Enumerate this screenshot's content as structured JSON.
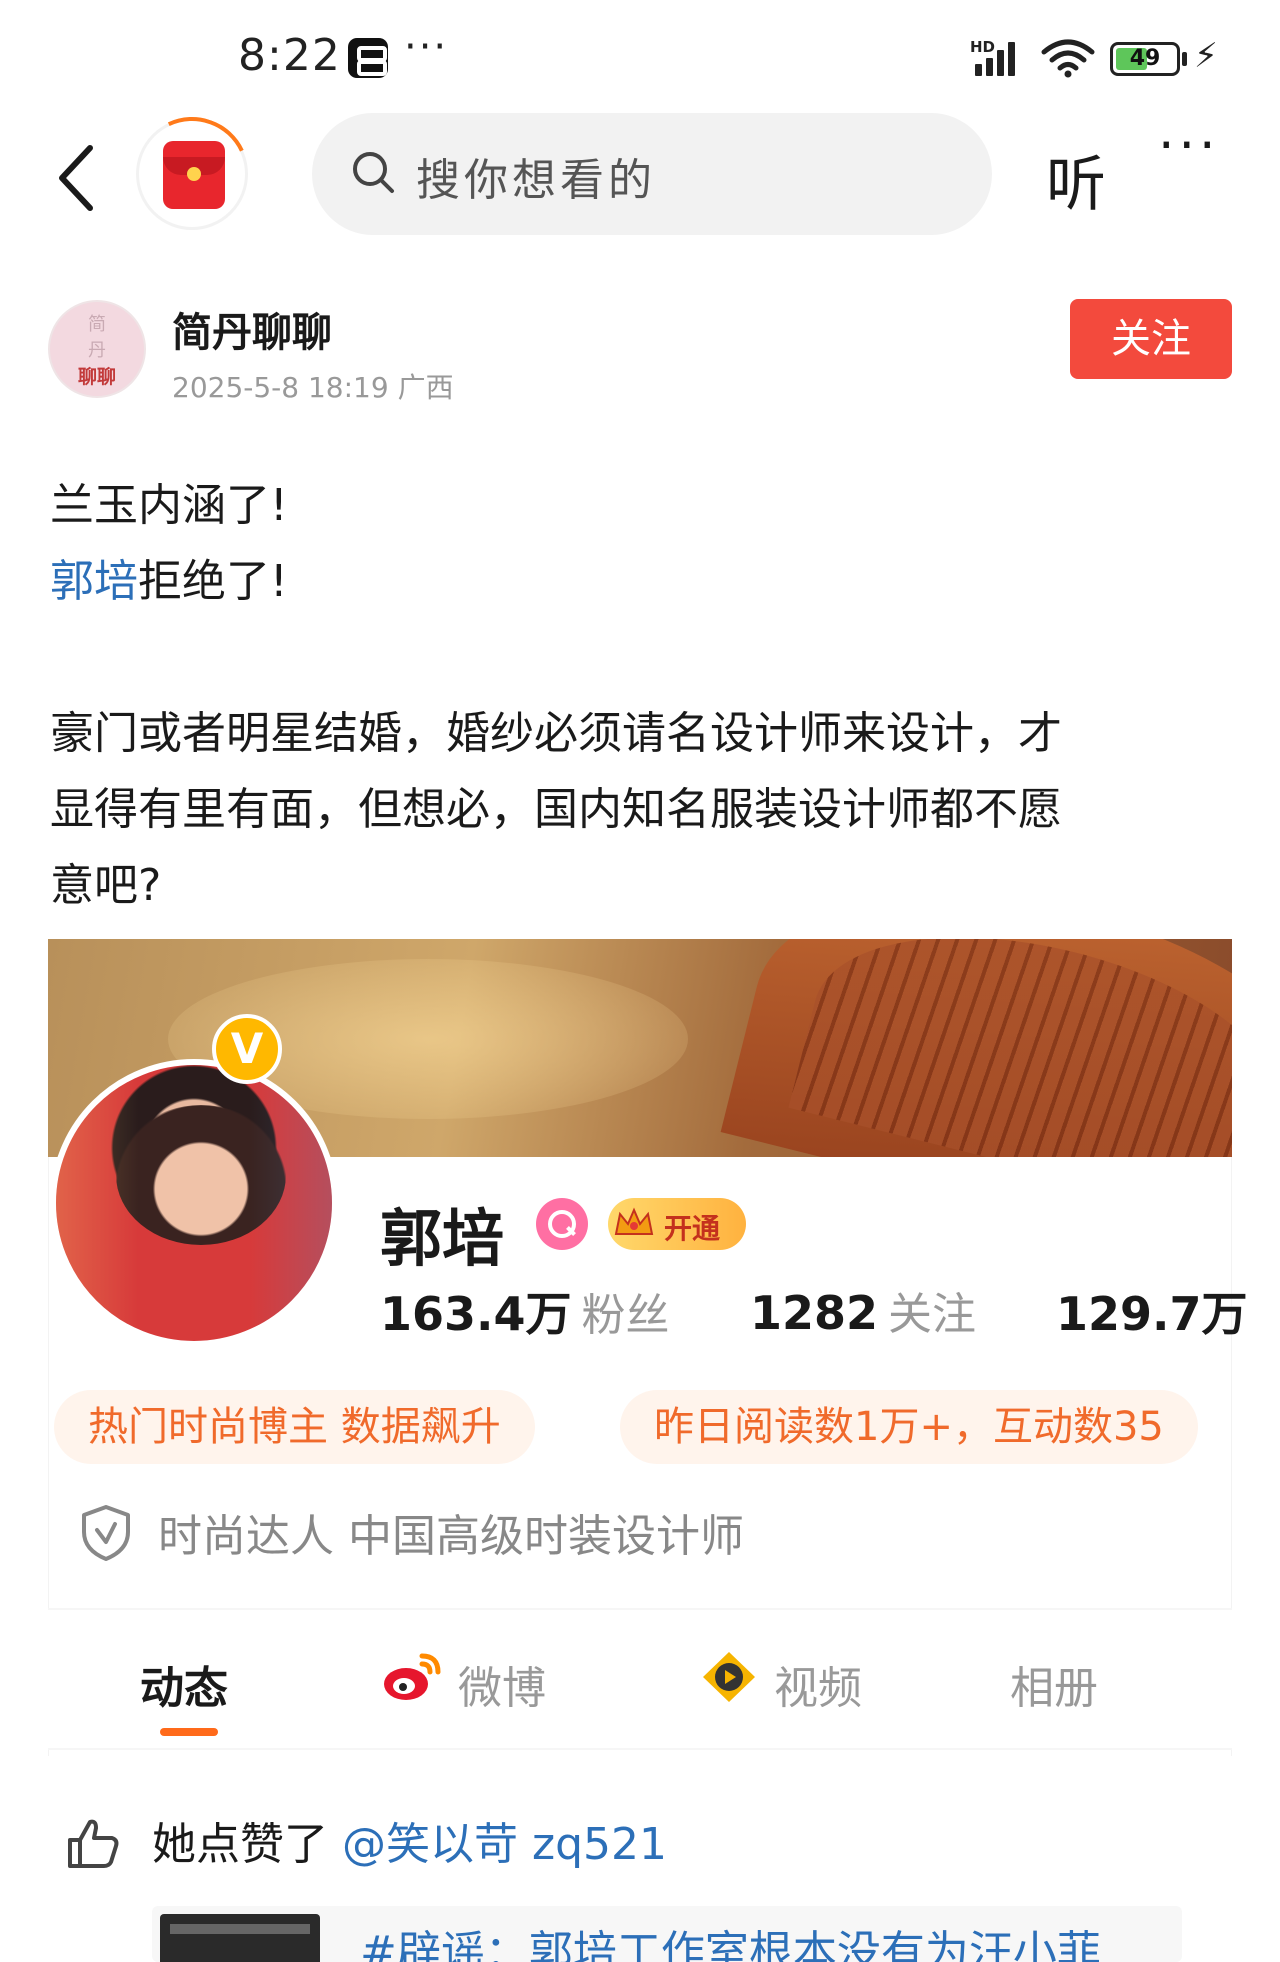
{
  "status_bar": {
    "time": "8:22",
    "dots": "···",
    "network": "HD",
    "battery": "49"
  },
  "nav": {
    "search_placeholder": "搜你想看的",
    "listen_label": "听",
    "more_label": "···"
  },
  "post": {
    "author_name": "简丹聊聊",
    "avatar_text": [
      "简",
      "丹",
      "聊聊"
    ],
    "meta": "2025-5-8 18:19 广西",
    "follow_label": "关注",
    "line1": "兰玉内涵了!",
    "mention": "郭培",
    "line2_rest": "拒绝了!",
    "paragraph_lines": [
      "豪门或者明星结婚，婚纱必须请名设计师来设计，才",
      "显得有里有面，但想必，国内知名服装设计师都不愿",
      "意吧?"
    ]
  },
  "profile_card": {
    "name": "郭培",
    "vip_label": "开通",
    "verified_mark": "V",
    "stats": [
      {
        "num": "163.4万",
        "label": "粉丝"
      },
      {
        "num": "1282",
        "label": "关注"
      },
      {
        "num": "129.7万",
        "label": ""
      }
    ],
    "tags": [
      "热门时尚博主 数据飙升",
      "昨日阅读数1万+，互动数35"
    ],
    "identity": "时尚达人 中国高级时装设计师",
    "tabs": [
      "动态",
      "微博",
      "视频",
      "相册"
    ],
    "activity": {
      "prefix": "她点赞了",
      "user": "@笑以苛 zq521",
      "repost_preview": "#辟谣：郭培工作室根本没有为汪小菲"
    }
  },
  "colors": {
    "accent_red": "#f34a3d",
    "link_blue": "#2c6fb8",
    "tag_orange": "#f06a2b",
    "tab_underline": "#ff6a1a"
  }
}
